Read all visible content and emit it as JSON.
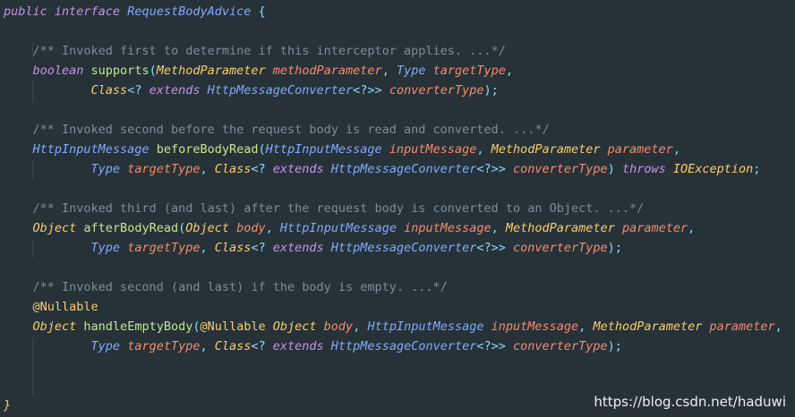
{
  "code": {
    "header": [
      {
        "t": "public ",
        "c": "kw"
      },
      {
        "t": "interface ",
        "c": "kw"
      },
      {
        "t": "RequestBodyAdvice ",
        "c": "type-blue"
      },
      {
        "t": "{",
        "c": "punct"
      }
    ],
    "comment1": "/** Invoked first to determine if this interceptor applies. ...*/",
    "supports_l1": [
      {
        "t": "boolean ",
        "c": "kw"
      },
      {
        "t": "supports",
        "c": "method"
      },
      {
        "t": "(",
        "c": "punct"
      },
      {
        "t": "MethodParameter ",
        "c": "type"
      },
      {
        "t": "methodParameter",
        "c": "param"
      },
      {
        "t": ", ",
        "c": "punct"
      },
      {
        "t": "Type ",
        "c": "type-blue"
      },
      {
        "t": "targetType",
        "c": "param"
      },
      {
        "t": ",",
        "c": "punct"
      }
    ],
    "supports_l2": [
      {
        "t": "Class",
        "c": "type"
      },
      {
        "t": "<? ",
        "c": "punct"
      },
      {
        "t": "extends ",
        "c": "kw"
      },
      {
        "t": "HttpMessageConverter",
        "c": "type-blue"
      },
      {
        "t": "<?>> ",
        "c": "punct"
      },
      {
        "t": "converterType",
        "c": "param"
      },
      {
        "t": ");",
        "c": "punct"
      }
    ],
    "comment2": "/** Invoked second before the request body is read and converted. ...*/",
    "before_l1": [
      {
        "t": "HttpInputMessage ",
        "c": "type-blue"
      },
      {
        "t": "beforeBodyRead",
        "c": "method"
      },
      {
        "t": "(",
        "c": "punct"
      },
      {
        "t": "HttpInputMessage ",
        "c": "type-blue"
      },
      {
        "t": "inputMessage",
        "c": "param"
      },
      {
        "t": ", ",
        "c": "punct"
      },
      {
        "t": "MethodParameter ",
        "c": "type"
      },
      {
        "t": "parameter",
        "c": "param"
      },
      {
        "t": ",",
        "c": "punct"
      }
    ],
    "before_l2": [
      {
        "t": "Type ",
        "c": "type-blue"
      },
      {
        "t": "targetType",
        "c": "param"
      },
      {
        "t": ", ",
        "c": "punct"
      },
      {
        "t": "Class",
        "c": "type"
      },
      {
        "t": "<? ",
        "c": "punct"
      },
      {
        "t": "extends ",
        "c": "kw"
      },
      {
        "t": "HttpMessageConverter",
        "c": "type-blue"
      },
      {
        "t": "<?>> ",
        "c": "punct"
      },
      {
        "t": "converterType",
        "c": "param"
      },
      {
        "t": ") ",
        "c": "punct"
      },
      {
        "t": "throws ",
        "c": "throws"
      },
      {
        "t": "IOException",
        "c": "type"
      },
      {
        "t": ";",
        "c": "punct"
      }
    ],
    "comment3": "/** Invoked third (and last) after the request body is converted to an Object. ...*/",
    "after_l1": [
      {
        "t": "Object ",
        "c": "type"
      },
      {
        "t": "afterBodyRead",
        "c": "method"
      },
      {
        "t": "(",
        "c": "punct"
      },
      {
        "t": "Object ",
        "c": "type"
      },
      {
        "t": "body",
        "c": "param"
      },
      {
        "t": ", ",
        "c": "punct"
      },
      {
        "t": "HttpInputMessage ",
        "c": "type-blue"
      },
      {
        "t": "inputMessage",
        "c": "param"
      },
      {
        "t": ", ",
        "c": "punct"
      },
      {
        "t": "MethodParameter ",
        "c": "type"
      },
      {
        "t": "parameter",
        "c": "param"
      },
      {
        "t": ",",
        "c": "punct"
      }
    ],
    "after_l2": [
      {
        "t": "Type ",
        "c": "type-blue"
      },
      {
        "t": "targetType",
        "c": "param"
      },
      {
        "t": ", ",
        "c": "punct"
      },
      {
        "t": "Class",
        "c": "type"
      },
      {
        "t": "<? ",
        "c": "punct"
      },
      {
        "t": "extends ",
        "c": "kw"
      },
      {
        "t": "HttpMessageConverter",
        "c": "type-blue"
      },
      {
        "t": "<?>> ",
        "c": "punct"
      },
      {
        "t": "converterType",
        "c": "param"
      },
      {
        "t": ");",
        "c": "punct"
      }
    ],
    "comment4": "/** Invoked second (and last) if the body is empty. ...*/",
    "annotation": "@Nullable",
    "empty_l1": [
      {
        "t": "Object ",
        "c": "type"
      },
      {
        "t": "handleEmptyBody",
        "c": "method"
      },
      {
        "t": "(",
        "c": "punct"
      },
      {
        "t": "@Nullable ",
        "c": "ann"
      },
      {
        "t": "Object ",
        "c": "type"
      },
      {
        "t": "body",
        "c": "param"
      },
      {
        "t": ", ",
        "c": "punct"
      },
      {
        "t": "HttpInputMessage ",
        "c": "type-blue"
      },
      {
        "t": "inputMessage",
        "c": "param"
      },
      {
        "t": ", ",
        "c": "punct"
      },
      {
        "t": "MethodParameter ",
        "c": "type"
      },
      {
        "t": "parameter",
        "c": "param"
      },
      {
        "t": ",",
        "c": "punct"
      }
    ],
    "empty_l2": [
      {
        "t": "Type ",
        "c": "type-blue"
      },
      {
        "t": "targetType",
        "c": "param"
      },
      {
        "t": ", ",
        "c": "punct"
      },
      {
        "t": "Class",
        "c": "type"
      },
      {
        "t": "<? ",
        "c": "punct"
      },
      {
        "t": "extends ",
        "c": "kw"
      },
      {
        "t": "HttpMessageConverter",
        "c": "type-blue"
      },
      {
        "t": "<?>> ",
        "c": "punct"
      },
      {
        "t": "converterType",
        "c": "param"
      },
      {
        "t": ");",
        "c": "punct"
      }
    ],
    "closing": "}"
  },
  "watermark": "https://blog.csdn.net/haduwi",
  "colors": {
    "background": "#263238",
    "keyword": "#C792EA",
    "type": "#FFCB6B",
    "type_blue": "#82AAFF",
    "method": "#C3E88D",
    "param": "#F78C6C",
    "punct": "#89DDFF",
    "comment": "#7F8C98"
  }
}
